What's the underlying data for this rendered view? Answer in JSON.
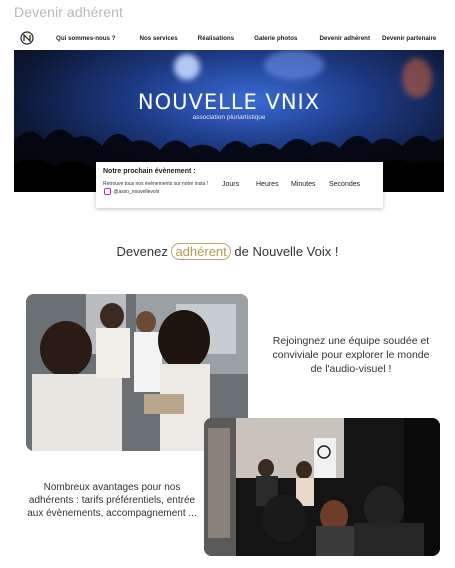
{
  "page": {
    "title": "Devenir adhérent"
  },
  "nav": {
    "items": [
      "Qui sommes-nous ?",
      "Nos services",
      "Réalisations",
      "Galerie photos",
      "Devenir adhérent",
      "Devenir partenaire"
    ]
  },
  "hero": {
    "brand": "NOUVELLE VNIX",
    "subtitle": "association pluriartistique"
  },
  "event": {
    "title": "Notre prochain évènement :",
    "desc_before": "Retrouve tous nos évènements sur notre insta ! ",
    "handle": "@asso_nouvellevoix",
    "countdown": [
      "Jours",
      "Heures",
      "Minutes",
      "Secondes"
    ]
  },
  "join": {
    "prefix": "Devenez ",
    "highlight": "adhérent",
    "suffix": " de Nouvelle Voix !"
  },
  "sections": {
    "team_text": "Rejoingnez une équipe soudée et conviviale pour explorer le monde de l'audio-visuel !",
    "benefits_text": "Nombreux avantages pour nos adhérents : tarifs préférentiels, entrée aux évènements, accompagnement ..."
  },
  "colors": {
    "accent": "#b59a4e",
    "hero_blue": "#2d5bc7",
    "insta": "#d6249f"
  },
  "icons": {
    "logo": "nouvelle-voix-logo",
    "instagram": "instagram-icon"
  }
}
